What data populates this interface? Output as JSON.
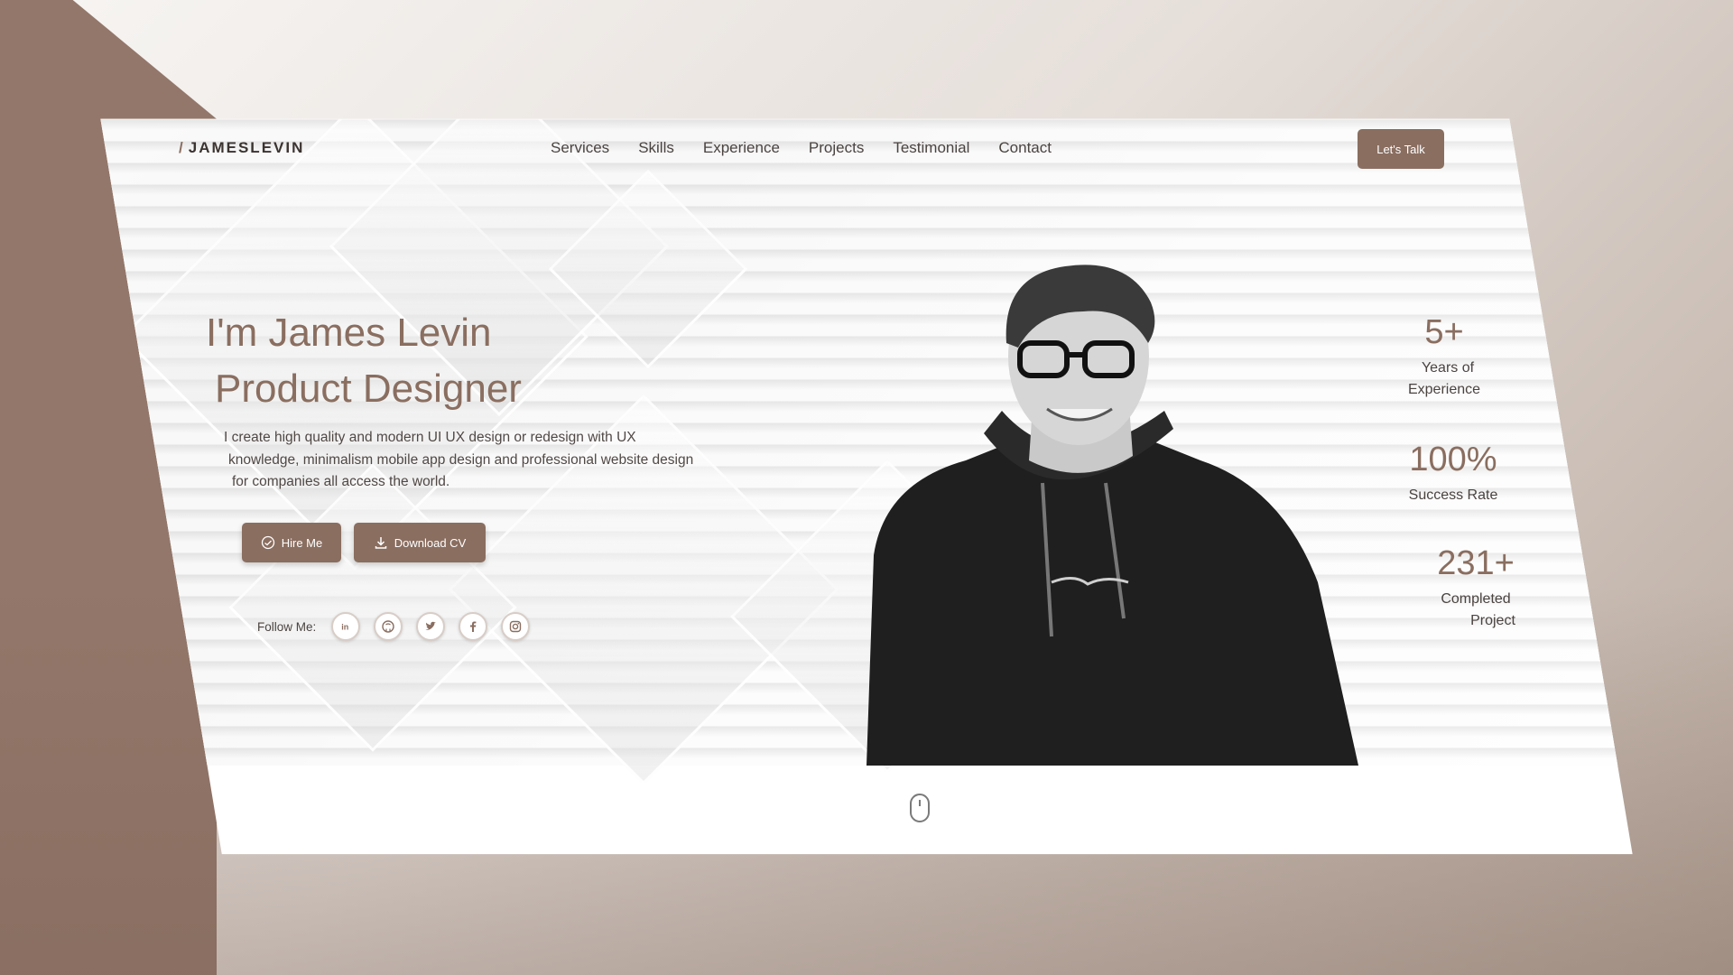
{
  "nav": {
    "logo_slash": "/",
    "logo_text": "JAMESLEVIN",
    "links": [
      "Services",
      "Skills",
      "Experience",
      "Projects",
      "Testimonial",
      "Contact"
    ],
    "cta_label": "Let's Talk"
  },
  "hero": {
    "title_line1": "I'm James Levin",
    "title_line2": "Product Designer",
    "description_lines": [
      "I create high quality and modern UI UX design or redesign with UX",
      "knowledge, minimalism mobile app design and professional website design",
      "for companies all access the world."
    ],
    "hire_label": "Hire Me",
    "cv_label": "Download CV",
    "follow_label": "Follow Me:",
    "socials": [
      "linkedin-icon",
      "github-icon",
      "twitter-icon",
      "facebook-icon",
      "instagram-icon"
    ]
  },
  "stats": [
    {
      "value": "5+",
      "label_line1": "Years of",
      "label_line2": "Experience"
    },
    {
      "value": "100%",
      "label_line1": "Success Rate",
      "label_line2": ""
    },
    {
      "value": "231+",
      "label_line1": "Completed",
      "label_line2": "Project"
    }
  ],
  "colors": {
    "accent": "#8a6e60",
    "text_dark": "#3b3330",
    "backdrop_brown": "#93776a"
  }
}
